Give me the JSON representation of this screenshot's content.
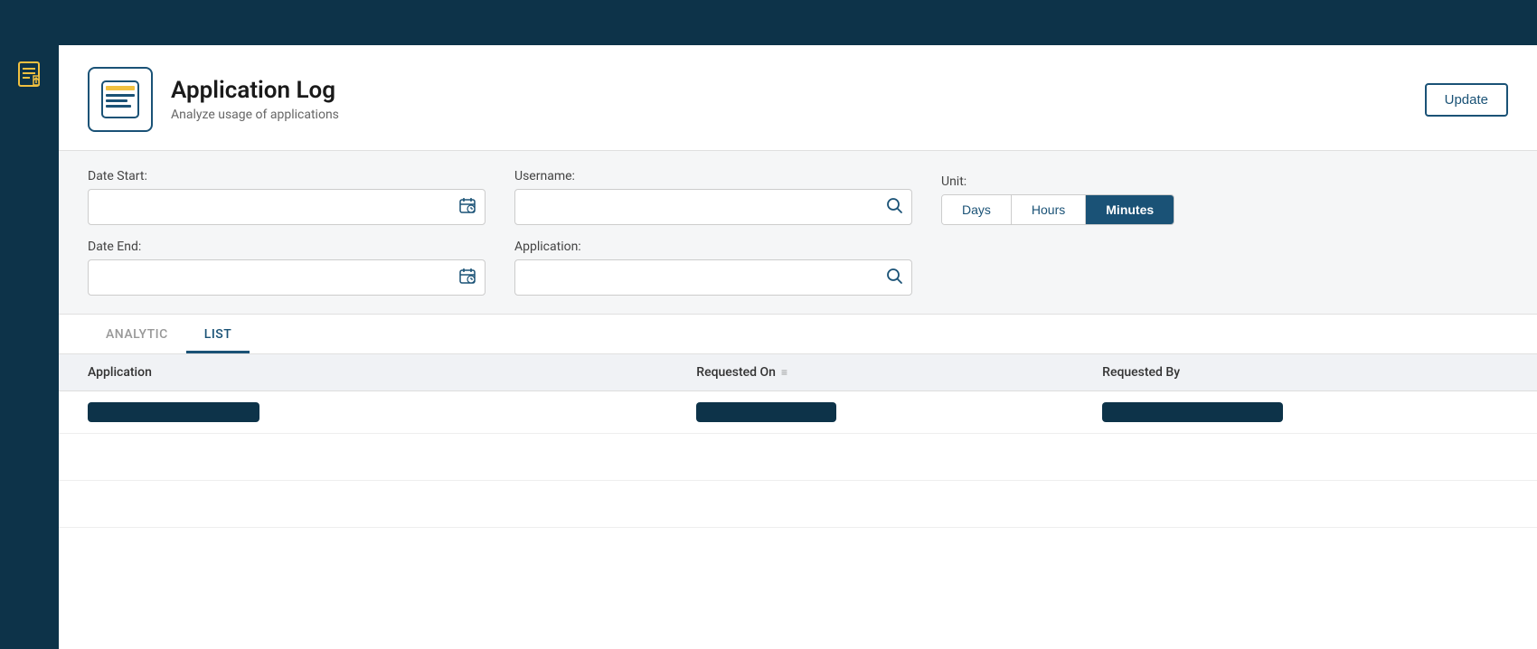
{
  "topbar": {},
  "sidebar": {
    "icon_label": "export-icon"
  },
  "header": {
    "title": "Application Log",
    "subtitle": "Analyze usage of applications",
    "update_button": "Update"
  },
  "filters": {
    "date_start_label": "Date Start:",
    "date_start_placeholder": "",
    "date_end_label": "Date End:",
    "date_end_placeholder": "",
    "username_label": "Username:",
    "username_placeholder": "",
    "application_label": "Application:",
    "application_placeholder": "",
    "unit_label": "Unit:",
    "unit_options": [
      {
        "label": "Days",
        "active": false
      },
      {
        "label": "Hours",
        "active": false
      },
      {
        "label": "Minutes",
        "active": true
      }
    ]
  },
  "tabs": [
    {
      "label": "ANALYTIC",
      "active": false
    },
    {
      "label": "LIST",
      "active": true
    }
  ],
  "table": {
    "columns": [
      {
        "label": "Application"
      },
      {
        "label": "Requested On"
      },
      {
        "label": "Requested By"
      }
    ],
    "rows": [
      {
        "has_data": true
      },
      {
        "has_data": false
      },
      {
        "has_data": false
      }
    ]
  }
}
